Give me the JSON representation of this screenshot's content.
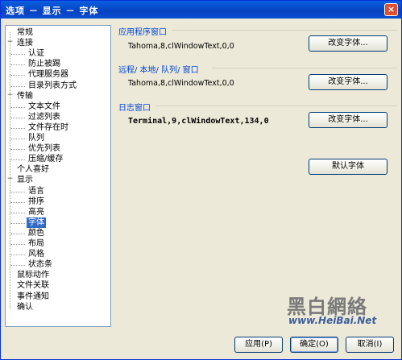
{
  "window": {
    "title": "选项 － 显示 － 字体",
    "close_glyph": "×"
  },
  "tree": [
    {
      "label": "常规",
      "level": 0,
      "expander": ""
    },
    {
      "label": "连接",
      "level": 0,
      "expander": "−"
    },
    {
      "label": "认证",
      "level": 1,
      "expander": ""
    },
    {
      "label": "防止被踢",
      "level": 1,
      "expander": ""
    },
    {
      "label": "代理服务器",
      "level": 1,
      "expander": ""
    },
    {
      "label": "目录列表方式",
      "level": 1,
      "expander": ""
    },
    {
      "label": "传输",
      "level": 0,
      "expander": "−"
    },
    {
      "label": "文本文件",
      "level": 1,
      "expander": ""
    },
    {
      "label": "过滤列表",
      "level": 1,
      "expander": ""
    },
    {
      "label": "文件存在时",
      "level": 1,
      "expander": ""
    },
    {
      "label": "队列",
      "level": 1,
      "expander": ""
    },
    {
      "label": "优先列表",
      "level": 1,
      "expander": ""
    },
    {
      "label": "压缩/缓存",
      "level": 1,
      "expander": ""
    },
    {
      "label": "个人喜好",
      "level": 0,
      "expander": ""
    },
    {
      "label": "显示",
      "level": 0,
      "expander": "−"
    },
    {
      "label": "语言",
      "level": 1,
      "expander": ""
    },
    {
      "label": "排序",
      "level": 1,
      "expander": ""
    },
    {
      "label": "高亮",
      "level": 1,
      "expander": ""
    },
    {
      "label": "字体",
      "level": 1,
      "expander": "",
      "selected": true
    },
    {
      "label": "颜色",
      "level": 1,
      "expander": ""
    },
    {
      "label": "布局",
      "level": 1,
      "expander": ""
    },
    {
      "label": "风格",
      "level": 1,
      "expander": ""
    },
    {
      "label": "状态条",
      "level": 1,
      "expander": ""
    },
    {
      "label": "鼠标动作",
      "level": 0,
      "expander": ""
    },
    {
      "label": "文件关联",
      "level": 0,
      "expander": ""
    },
    {
      "label": "事件通知",
      "level": 0,
      "expander": ""
    },
    {
      "label": "确认",
      "level": 0,
      "expander": ""
    }
  ],
  "groups": {
    "app_window": {
      "label": "应用程序窗口",
      "font_value": "Tahoma,8,clWindowText,0,0",
      "button": "改变字体..."
    },
    "remote_local_queue": {
      "label": "远程/ 本地/ 队列/ 窗口",
      "font_value": "Tahoma,8,clWindowText,0,0",
      "button": "改变字体..."
    },
    "log_window": {
      "label": "日志窗口",
      "font_value": "Terminal,9,clWindowText,134,0",
      "button": "改变字体..."
    }
  },
  "default_font_button": "默认字体",
  "buttons": {
    "apply": "应用(P)",
    "ok": "确定(O)",
    "cancel": "取消(I)"
  },
  "watermark": {
    "chinese": "黑白網絡",
    "url": "www.HeiBai.Net"
  },
  "colors": {
    "selection": "#316ac5",
    "group_label": "#0046d5",
    "titlebar": "#0842c0"
  }
}
